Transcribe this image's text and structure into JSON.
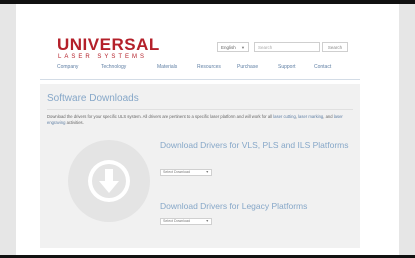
{
  "brand": {
    "logo_main": "UNIVERSAL",
    "logo_sub": "LASER SYSTEMS",
    "color": "#b4202a"
  },
  "header": {
    "language": {
      "selected": "English",
      "icon": "chevron-down-icon"
    },
    "search": {
      "placeholder": "Search",
      "button_label": "Search"
    }
  },
  "nav": {
    "items": [
      {
        "label": "Company"
      },
      {
        "label": "Technology"
      },
      {
        "label": "Materials"
      },
      {
        "label": "Resources"
      },
      {
        "label": "Purchase"
      },
      {
        "label": "Support"
      },
      {
        "label": "Contact"
      }
    ]
  },
  "main": {
    "title": "Software Downloads",
    "description_prefix": "Download the drivers for your specific ULS system. All drivers are pertinent to a specific laser platform and will work for all ",
    "link_laser_cutting": "laser cutting",
    "sep1": ", ",
    "link_laser_marking": "laser marking",
    "sep2": ", and ",
    "link_laser_engraving": "laser engraving",
    "description_suffix": " activities.",
    "download_icon": "download-arrow-icon",
    "section1": {
      "heading": "Download Drivers for VLS, PLS and ILS Platforms",
      "select_label": "Select Download"
    },
    "section2": {
      "heading": "Download Drivers for Legacy Platforms",
      "select_label": "Select Download"
    }
  },
  "colors": {
    "accent": "#86a7c8",
    "nav_text": "#5f7fa4",
    "content_bg": "#f1f1f1"
  }
}
